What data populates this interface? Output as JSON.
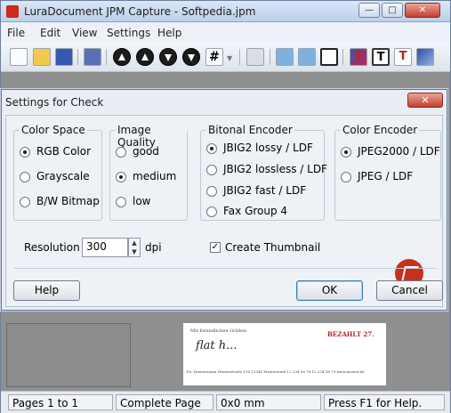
{
  "window": {
    "title": "LuraDocument JPM Capture - Softpedia.jpm"
  },
  "menu": [
    "File",
    "Edit",
    "View",
    "Settings",
    "Help"
  ],
  "toolbar": {
    "grid_label": "#",
    "t_red": "T",
    "t_black": "T",
    "t_red2": "T"
  },
  "document": {
    "greeting": "Mit freundlichen Grüßen",
    "signature": "flat h...",
    "stamp": "BEZAHLT 27.",
    "footer": "Fa. Mustermann  Musterstraße 150  12345 Musterstadt  12 234 56 78  12 234 56 79  www.muster.de"
  },
  "dialog": {
    "title": "Settings for Check",
    "close_label": "✕",
    "color_space": {
      "label": "Color Space",
      "options": [
        "RGB Color",
        "Grayscale",
        "B/W Bitmap"
      ],
      "selected": 0
    },
    "image_quality": {
      "label": "Image Quality",
      "options": [
        "good",
        "medium",
        "low"
      ],
      "selected": 1
    },
    "bitonal_encoder": {
      "label": "Bitonal Encoder",
      "options": [
        "JBIG2 lossy / LDF",
        "JBIG2 lossless / LDF",
        "JBIG2 fast / LDF",
        "Fax Group 4"
      ],
      "selected": 0
    },
    "color_encoder": {
      "label": "Color Encoder",
      "options": [
        "JPEG2000 / LDF",
        "JPEG / LDF"
      ],
      "selected": 0
    },
    "resolution": {
      "label": "Resolution",
      "value": "300",
      "unit": "dpi"
    },
    "thumbnail": {
      "label": "Create Thumbnail",
      "checked": true,
      "mark": "✓"
    },
    "buttons": {
      "help": "Help",
      "ok": "OK",
      "cancel": "Cancel"
    }
  },
  "status": [
    "Pages 1 to 1",
    "Complete Page",
    "0x0 mm",
    "Press F1 for Help."
  ]
}
